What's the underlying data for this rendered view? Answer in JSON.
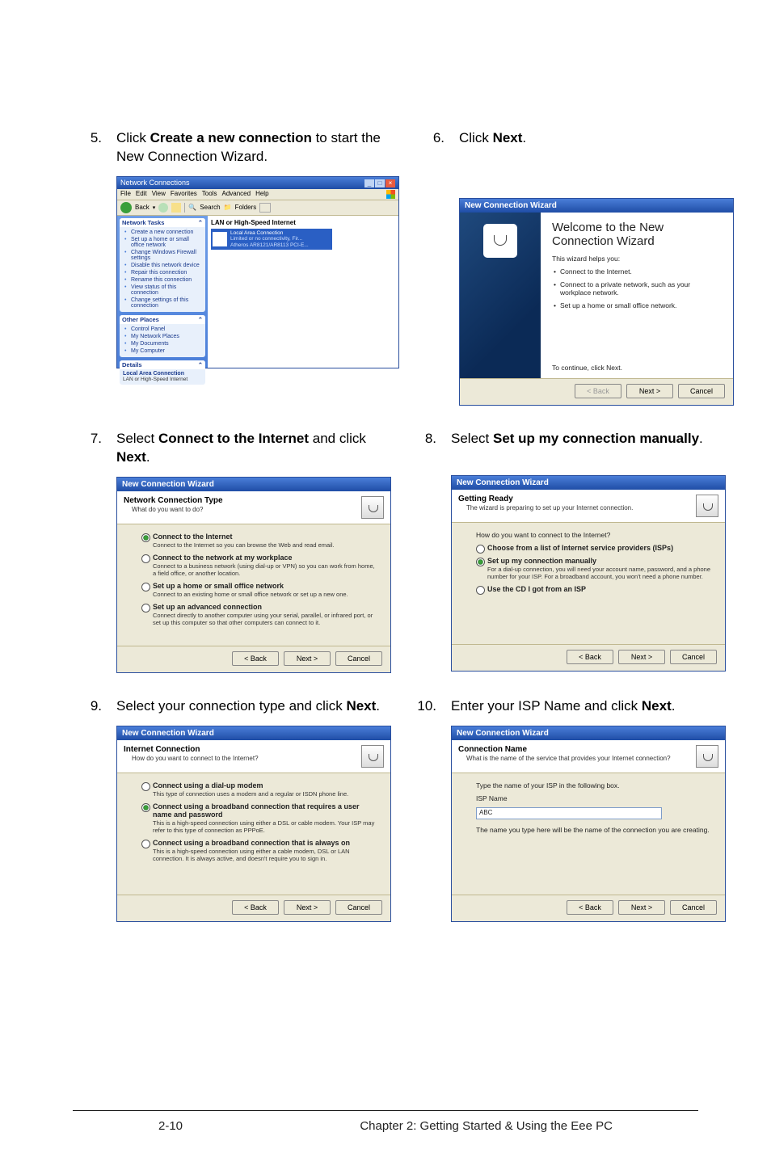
{
  "steps": {
    "s5": {
      "num": "5.",
      "text_pre": "Click ",
      "b1": "Create a new connection",
      "text_mid": " to start the New Connection Wizard."
    },
    "s6": {
      "num": "6.",
      "text_pre": "Click ",
      "b1": "Next",
      "text_post": "."
    },
    "s7": {
      "num": "7.",
      "text_pre": "Select ",
      "b1": "Connect to the Internet",
      "text_mid": " and click ",
      "b2": "Next",
      "text_post": "."
    },
    "s8": {
      "num": "8.",
      "text_pre": "Select ",
      "b1": "Set up my connection manually",
      "text_post": "."
    },
    "s9": {
      "num": "9.",
      "text_pre": "Select your connection type and click ",
      "b1": "Next",
      "text_post": "."
    },
    "s10": {
      "num": "10.",
      "text_pre": "Enter your ISP Name and click ",
      "b1": "Next",
      "text_post": "."
    }
  },
  "netconn": {
    "title": "Network Connections",
    "menu": [
      "File",
      "Edit",
      "View",
      "Favorites",
      "Tools",
      "Advanced",
      "Help"
    ],
    "toolbar": {
      "back": "Back",
      "search": "Search",
      "folders": "Folders"
    },
    "side": {
      "tasks_title": "Network Tasks",
      "tasks": [
        "Create a new connection",
        "Set up a home or small office network",
        "Change Windows Firewall settings",
        "Disable this network device",
        "Repair this connection",
        "Rename this connection",
        "View status of this connection",
        "Change settings of this connection"
      ],
      "places_title": "Other Places",
      "places": [
        "Control Panel",
        "My Network Places",
        "My Documents",
        "My Computer"
      ],
      "details_title": "Details",
      "details": [
        "Local Area Connection",
        "LAN or High-Speed Internet"
      ]
    },
    "main": {
      "cat": "LAN or High-Speed Internet",
      "lan_title": "Local Area Connection",
      "lan_sub1": "Limited or no connectivity, Fir...",
      "lan_sub2": "Atheros AR8121/AR8113 PCI-E..."
    }
  },
  "wiz6": {
    "title": "New Connection Wizard",
    "heading": "Welcome to the New Connection Wizard",
    "intro": "This wizard helps you:",
    "bullets": [
      "Connect to the Internet.",
      "Connect to a private network, such as your workplace network.",
      "Set up a home or small office network."
    ],
    "cont": "To continue, click Next.",
    "back": "< Back",
    "next": "Next >",
    "cancel": "Cancel"
  },
  "wiz7": {
    "title": "New Connection Wizard",
    "h": "Network Connection Type",
    "sub": "What do you want to do?",
    "o1t": "Connect to the Internet",
    "o1s": "Connect to the Internet so you can browse the Web and read email.",
    "o2t": "Connect to the network at my workplace",
    "o2s": "Connect to a business network (using dial-up or VPN) so you can work from home, a field office, or another location.",
    "o3t": "Set up a home or small office network",
    "o3s": "Connect to an existing home or small office network or set up a new one.",
    "o4t": "Set up an advanced connection",
    "o4s": "Connect directly to another computer using your serial, parallel, or infrared port, or set up this computer so that other computers can connect to it.",
    "back": "< Back",
    "next": "Next >",
    "cancel": "Cancel"
  },
  "wiz8": {
    "title": "New Connection Wizard",
    "h": "Getting Ready",
    "sub": "The wizard is preparing to set up your Internet connection.",
    "q": "How do you want to connect to the Internet?",
    "o1t": "Choose from a list of Internet service providers (ISPs)",
    "o2t": "Set up my connection manually",
    "o2s": "For a dial-up connection, you will need your account name, password, and a phone number for your ISP. For a broadband account, you won't need a phone number.",
    "o3t": "Use the CD I got from an ISP",
    "back": "< Back",
    "next": "Next >",
    "cancel": "Cancel"
  },
  "wiz9": {
    "title": "New Connection Wizard",
    "h": "Internet Connection",
    "sub": "How do you want to connect to the Internet?",
    "o1t": "Connect using a dial-up modem",
    "o1s": "This type of connection uses a modem and a regular or ISDN phone line.",
    "o2t": "Connect using a broadband connection that requires a user name and password",
    "o2s": "This is a high-speed connection using either a DSL or cable modem. Your ISP may refer to this type of connection as PPPoE.",
    "o3t": "Connect using a broadband connection that is always on",
    "o3s": "This is a high-speed connection using either a cable modem, DSL or LAN connection. It is always active, and doesn't require you to sign in.",
    "back": "< Back",
    "next": "Next >",
    "cancel": "Cancel"
  },
  "wiz10": {
    "title": "New Connection Wizard",
    "h": "Connection Name",
    "sub": "What is the name of the service that provides your Internet connection?",
    "label": "Type the name of your ISP in the following box.",
    "field": "ISP Name",
    "value": "ABC",
    "note": "The name you type here will be the name of the connection you are creating.",
    "back": "< Back",
    "next": "Next >",
    "cancel": "Cancel"
  },
  "footer": {
    "left": "2-10",
    "right": "Chapter 2: Getting Started & Using the Eee PC"
  }
}
